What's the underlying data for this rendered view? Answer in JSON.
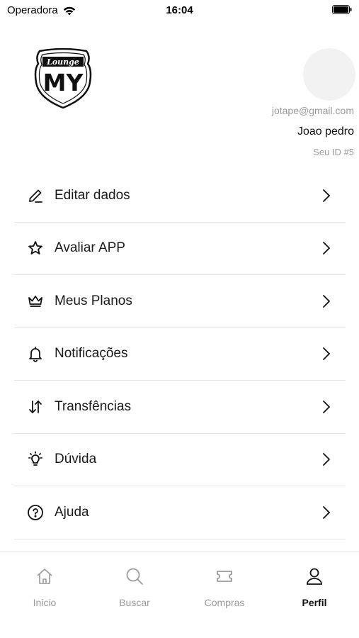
{
  "status_bar": {
    "carrier": "Operadora",
    "time": "16:04"
  },
  "profile": {
    "logo_text_top": "Lounge",
    "logo_text_main": "MY",
    "email": "jotape@gmail.com",
    "name": "Joao pedro",
    "id_label": "Seu ID #5"
  },
  "menu": {
    "items": [
      {
        "label": "Editar dados",
        "icon": "pencil-icon"
      },
      {
        "label": "Avaliar APP",
        "icon": "star-icon"
      },
      {
        "label": "Meus Planos",
        "icon": "crown-icon"
      },
      {
        "label": "Notificações",
        "icon": "bell-icon"
      },
      {
        "label": "Transfências",
        "icon": "transfer-arrows-icon"
      },
      {
        "label": "Dúvida",
        "icon": "lightbulb-icon"
      },
      {
        "label": "Ajuda",
        "icon": "question-circle-icon"
      }
    ]
  },
  "tab_bar": {
    "tabs": [
      {
        "label": "Inicio",
        "icon": "home-icon",
        "active": false
      },
      {
        "label": "Buscar",
        "icon": "search-icon",
        "active": false
      },
      {
        "label": "Compras",
        "icon": "ticket-icon",
        "active": false
      },
      {
        "label": "Perfil",
        "icon": "user-icon",
        "active": true
      }
    ]
  },
  "colors": {
    "text_primary": "#111111",
    "text_muted": "#9a9a9a",
    "divider": "#e4e4e4",
    "avatar_placeholder": "#f2f2f2"
  }
}
